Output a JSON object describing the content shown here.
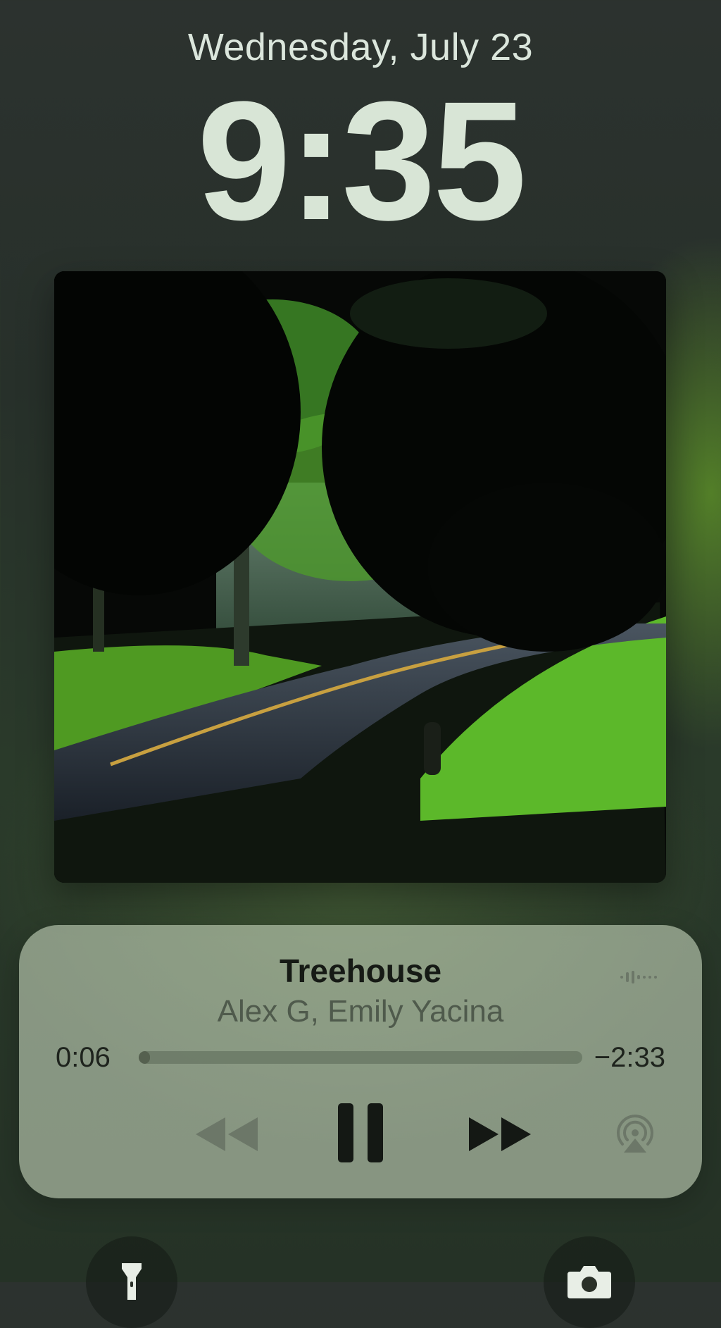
{
  "lock_screen": {
    "date": "Wednesday, July 23",
    "time": "9:35"
  },
  "now_playing": {
    "title": "Treehouse",
    "artist": "Alex G, Emily Yacina",
    "elapsed": "0:06",
    "remaining": "−2:33",
    "progress": 0.025,
    "playback_state": "playing"
  },
  "icons": {
    "audio_indicator": "waveform-icon",
    "rewind": "rewind-icon",
    "pause": "pause-icon",
    "forward": "fast-forward-icon",
    "airplay": "airplay-icon",
    "flashlight": "flashlight-icon",
    "camera": "camera-icon"
  },
  "colors": {
    "player_background": "#c4d2ba",
    "title_text": "#161a15",
    "artist_text": "#4f5a4c",
    "clock_text": "#d8e5d6"
  }
}
